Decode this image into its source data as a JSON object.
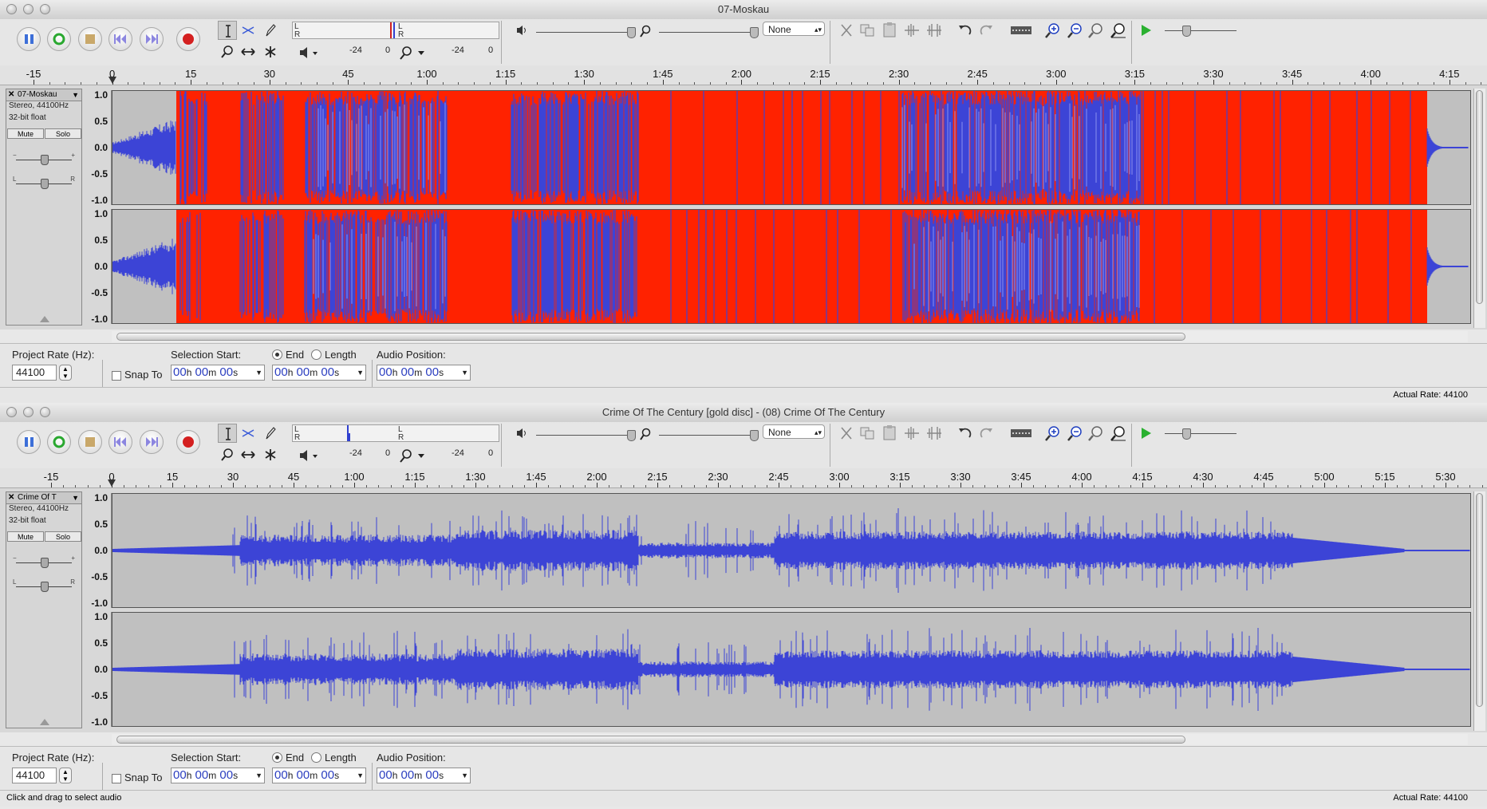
{
  "window1": {
    "title": "07-Moskau",
    "ruler_ticks": [
      "-15",
      "0",
      "15",
      "30",
      "45",
      "1:00",
      "1:15",
      "1:30",
      "1:45",
      "2:00",
      "2:15",
      "2:30",
      "2:45",
      "3:00",
      "3:15",
      "3:30",
      "3:45",
      "4:00",
      "4:15"
    ],
    "track": {
      "name": "07-Moskau",
      "format": "Stereo, 44100Hz",
      "bits": "32-bit float",
      "mute_label": "Mute",
      "solo_label": "Solo",
      "clipped": true
    },
    "scale_labels": [
      "1.0",
      "0.5",
      "0.0",
      "-0.5",
      "-1.0"
    ],
    "selection": {
      "project_rate_label": "Project Rate (Hz):",
      "project_rate_value": "44100",
      "snap_to_label": "Snap To",
      "selection_start_label": "Selection Start:",
      "end_label": "End",
      "length_label": "Length",
      "audio_position_label": "Audio Position:",
      "start_time": [
        "00",
        "h",
        "00",
        "m",
        "00",
        "s"
      ],
      "end_time": [
        "00",
        "h",
        "00",
        "m",
        "00",
        "s"
      ],
      "audio_position": [
        "00",
        "h",
        "00",
        "m",
        "00",
        "s"
      ],
      "end_selected": true
    },
    "status_left": "",
    "actual_rate": "Actual Rate: 44100"
  },
  "window2": {
    "title": "Crime Of The Century [gold disc] - (08) Crime Of The Century",
    "ruler_ticks": [
      "-15",
      "0",
      "15",
      "30",
      "45",
      "1:00",
      "1:15",
      "1:30",
      "1:45",
      "2:00",
      "2:15",
      "2:30",
      "2:45",
      "3:00",
      "3:15",
      "3:30",
      "3:45",
      "4:00",
      "4:15",
      "4:30",
      "4:45",
      "5:00",
      "5:15",
      "5:30"
    ],
    "track": {
      "name": "Crime Of T",
      "format": "Stereo, 44100Hz",
      "bits": "32-bit float",
      "mute_label": "Mute",
      "solo_label": "Solo",
      "clipped": false
    },
    "scale_labels": [
      "1.0",
      "0.5",
      "0.0",
      "-0.5",
      "-1.0"
    ],
    "selection": {
      "project_rate_label": "Project Rate (Hz):",
      "project_rate_value": "44100",
      "snap_to_label": "Snap To",
      "selection_start_label": "Selection Start:",
      "end_label": "End",
      "length_label": "Length",
      "audio_position_label": "Audio Position:",
      "start_time": [
        "00",
        "h",
        "00",
        "m",
        "00",
        "s"
      ],
      "end_time": [
        "00",
        "h",
        "00",
        "m",
        "00",
        "s"
      ],
      "audio_position": [
        "00",
        "h",
        "00",
        "m",
        "00",
        "s"
      ],
      "end_selected": true
    },
    "status_left": "Click and drag to select audio",
    "actual_rate": "Actual Rate: 44100"
  },
  "toolbar": {
    "meter_left_label": "L",
    "meter_right_label": "R",
    "meter_scale_a": "-24",
    "meter_scale_b": "0",
    "playback_device": "None",
    "icons": [
      "pause-icon",
      "loop-icon",
      "stop-icon",
      "skip-start-icon",
      "skip-end-icon",
      "record-icon",
      "selection-tool-icon",
      "envelope-tool-icon",
      "draw-tool-icon",
      "zoom-tool-icon",
      "timeshift-tool-icon",
      "multi-tool-icon",
      "speaker-icon",
      "microphone-icon",
      "cut-icon",
      "copy-icon",
      "paste-icon",
      "trim-icon",
      "silence-icon",
      "undo-icon",
      "redo-icon",
      "sync-lock-icon",
      "zoom-in-icon",
      "zoom-out-icon",
      "fit-selection-icon",
      "fit-project-icon",
      "play-at-speed-icon"
    ]
  },
  "colors": {
    "waveform_blue": "#3c44d6",
    "waveform_light": "#8a90f0",
    "clip_red": "#ff2200",
    "background": "#c0c0c0",
    "time_text": "#2b3ec0"
  }
}
